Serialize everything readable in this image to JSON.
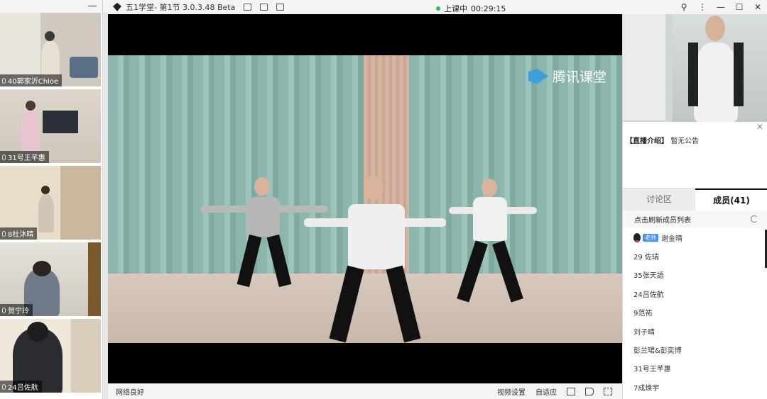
{
  "window": {
    "title": "五1学堂- 第1节 3.0.3.48 Beta",
    "status_text": "上课中",
    "timer": "00:29:15"
  },
  "left_panel": {
    "participants": [
      {
        "name": "40郭家沂Chloe"
      },
      {
        "name": "31号王芊惠"
      },
      {
        "name": "8杜沐晴"
      },
      {
        "name": "贺宁玲"
      },
      {
        "name": "24吕佐航"
      }
    ]
  },
  "main": {
    "watermark": "腾讯课堂",
    "network_status": "网络良好",
    "controls": {
      "video_settings": "视频设置",
      "adaptive": "自适应"
    }
  },
  "right_panel": {
    "announcement_label": "【直播介绍】",
    "announcement_text": "暂无公告",
    "tabs": [
      {
        "label": "讨论区"
      },
      {
        "label": "成员(41)"
      }
    ],
    "refresh_text": "点击刷新成员列表",
    "teacher_badge": "老师",
    "members": [
      {
        "name": "谢金晴"
      },
      {
        "name": "29 佐瑞"
      },
      {
        "name": "35张天語"
      },
      {
        "name": "24吕佐航"
      },
      {
        "name": "9范祐"
      },
      {
        "name": "刘子晴"
      },
      {
        "name": "彭兰珺&彭奕博"
      },
      {
        "name": "31号王芊惠"
      },
      {
        "name": "7成焕宇"
      }
    ]
  },
  "colors": {
    "live_dot": "#1fc35a",
    "teacher_badge": "#4c8df0",
    "curtain": "#8bb5ad"
  }
}
